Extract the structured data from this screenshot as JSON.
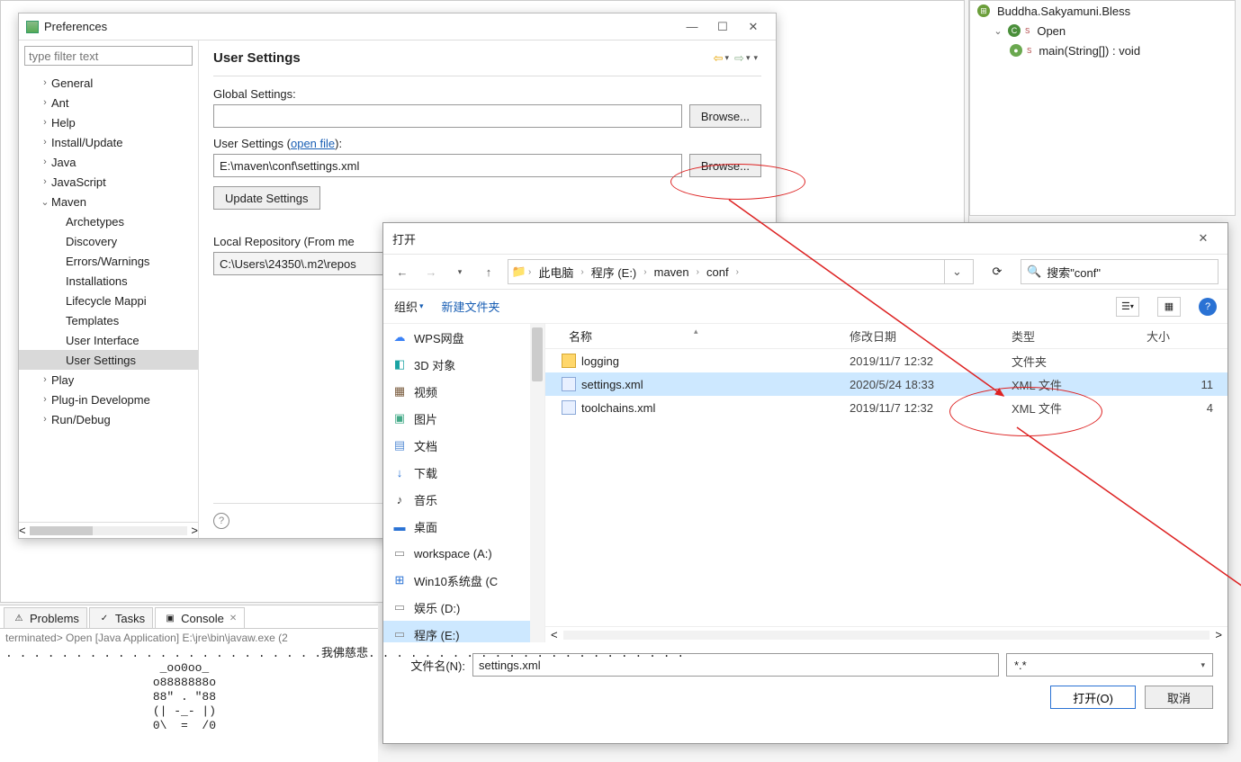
{
  "prefs": {
    "title": "Preferences",
    "filter_placeholder": "type filter text",
    "heading": "User Settings",
    "global_settings_label": "Global Settings:",
    "global_settings_value": "",
    "user_settings_label_prefix": "User Settings (",
    "open_file_link": "open file",
    "user_settings_label_suffix": "):",
    "user_settings_value": "E:\\maven\\conf\\settings.xml",
    "browse": "Browse...",
    "update_settings": "Update Settings",
    "local_repo_label": "Local Repository (From me",
    "local_repo_value": "C:\\Users\\24350\\.m2\\repos",
    "tree": [
      {
        "l": "General",
        "d": 1,
        "tw": ">"
      },
      {
        "l": "Ant",
        "d": 1,
        "tw": ">"
      },
      {
        "l": "Help",
        "d": 1,
        "tw": ">"
      },
      {
        "l": "Install/Update",
        "d": 1,
        "tw": ">"
      },
      {
        "l": "Java",
        "d": 1,
        "tw": ">"
      },
      {
        "l": "JavaScript",
        "d": 1,
        "tw": ">"
      },
      {
        "l": "Maven",
        "d": 1,
        "tw": "v"
      },
      {
        "l": "Archetypes",
        "d": 2,
        "tw": ""
      },
      {
        "l": "Discovery",
        "d": 2,
        "tw": ""
      },
      {
        "l": "Errors/Warnings",
        "d": 2,
        "tw": ""
      },
      {
        "l": "Installations",
        "d": 2,
        "tw": ""
      },
      {
        "l": "Lifecycle Mappi",
        "d": 2,
        "tw": ""
      },
      {
        "l": "Templates",
        "d": 2,
        "tw": ""
      },
      {
        "l": "User Interface",
        "d": 2,
        "tw": ""
      },
      {
        "l": "User Settings",
        "d": 2,
        "tw": "",
        "sel": true
      },
      {
        "l": "Play",
        "d": 1,
        "tw": ">"
      },
      {
        "l": "Plug-in Developme",
        "d": 1,
        "tw": ">"
      },
      {
        "l": "Run/Debug",
        "d": 1,
        "tw": ">"
      }
    ]
  },
  "filedlg": {
    "title": "打开",
    "crumbs": [
      "此电脑",
      "程序 (E:)",
      "maven",
      "conf"
    ],
    "search_placeholder": "搜索\"conf\"",
    "organize": "组织",
    "new_folder": "新建文件夹",
    "columns": {
      "name": "名称",
      "date": "修改日期",
      "type": "类型",
      "size": "大小"
    },
    "side": [
      {
        "l": "WPS网盘",
        "i": "☁",
        "c": "#3b82f6"
      },
      {
        "l": "3D 对象",
        "i": "◧",
        "c": "#1aa3a3"
      },
      {
        "l": "视频",
        "i": "▦",
        "c": "#7a5c3e"
      },
      {
        "l": "图片",
        "i": "▣",
        "c": "#4a8"
      },
      {
        "l": "文档",
        "i": "▤",
        "c": "#5a8fd6"
      },
      {
        "l": "下载",
        "i": "↓",
        "c": "#2a72d4"
      },
      {
        "l": "音乐",
        "i": "♪",
        "c": "#333"
      },
      {
        "l": "桌面",
        "i": "▬",
        "c": "#2a72d4"
      },
      {
        "l": "workspace (A:)",
        "i": "▭",
        "c": "#888"
      },
      {
        "l": "Win10系统盘 (C",
        "i": "⊞",
        "c": "#2a72d4"
      },
      {
        "l": "娱乐 (D:)",
        "i": "▭",
        "c": "#888"
      },
      {
        "l": "程序 (E:)",
        "i": "▭",
        "c": "#888",
        "sel": true
      }
    ],
    "rows": [
      {
        "name": "logging",
        "date": "2019/11/7 12:32",
        "type": "文件夹",
        "size": "",
        "ico": "folder"
      },
      {
        "name": "settings.xml",
        "date": "2020/5/24 18:33",
        "type": "XML 文件",
        "size": "11",
        "ico": "xml",
        "sel": true
      },
      {
        "name": "toolchains.xml",
        "date": "2019/11/7 12:32",
        "type": "XML 文件",
        "size": "4",
        "ico": "xml"
      }
    ],
    "filename_label": "文件名(N):",
    "filename_value": "settings.xml",
    "filter_value": "*.*",
    "open_btn": "打开(O)",
    "cancel_btn": "取消"
  },
  "outline": {
    "items": [
      {
        "l": "Buddha.Sakyamuni.Bless",
        "d": 0,
        "i": "j"
      },
      {
        "l": "Open",
        "d": 1,
        "i": "c",
        "tw": "v"
      },
      {
        "l": "main(String[]) : void",
        "d": 2,
        "i": "m"
      }
    ]
  },
  "bottom": {
    "tabs": [
      {
        "l": "Problems",
        "i": "⚠"
      },
      {
        "l": "Tasks",
        "i": "✓"
      },
      {
        "l": "Console",
        "i": "▣",
        "active": true
      }
    ],
    "status": "terminated> Open [Java Application] E:\\jre\\bin\\javaw.exe (2",
    "output": ". . . . . . . . . . . . . . . . . . . . . . .我佛慈悲. . . . . . . . . . . . . . . . . . . . . . .\n                      _oo0oo_\n                     o8888888o\n                     88\" . \"88\n                     (| -_- |)\n                     0\\  =  /0"
  }
}
